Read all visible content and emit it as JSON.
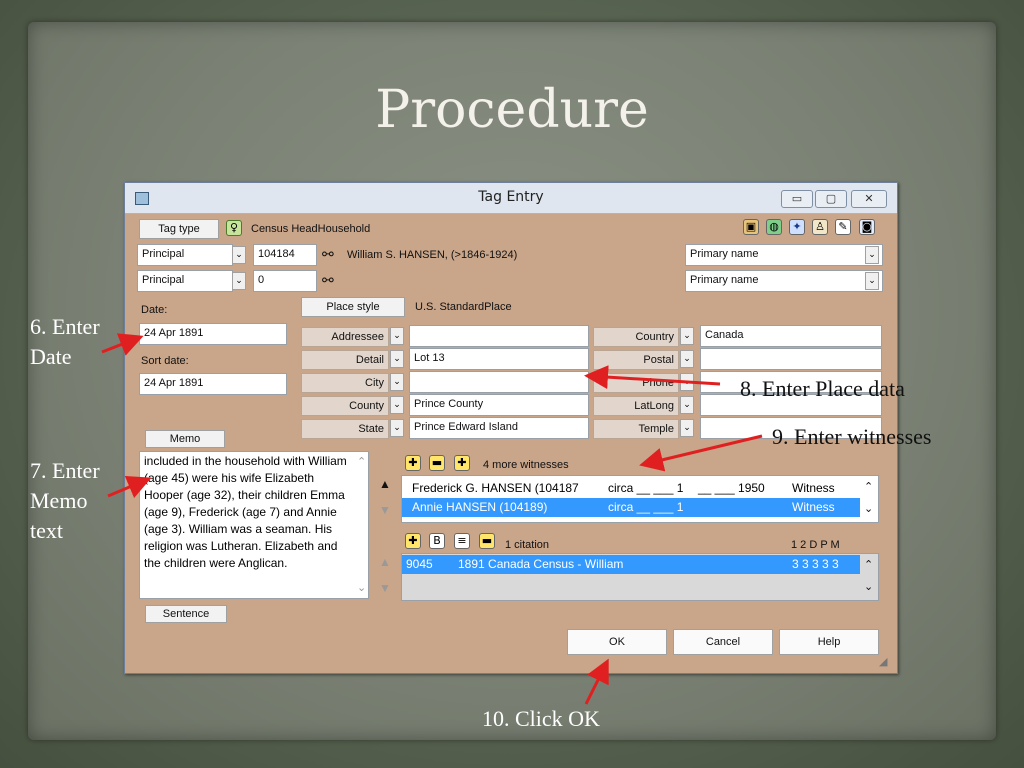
{
  "slide": {
    "title": "Procedure"
  },
  "notes": {
    "date": "6. Enter\nDate",
    "memo": "7. Enter\nMemo\ntext",
    "place": "8. Enter Place data",
    "witnesses": "9. Enter witnesses",
    "ok": "10. Click OK"
  },
  "window": {
    "title": "Tag Entry",
    "buttons": {
      "minimize": "▭",
      "maximize": "▢",
      "close": "✕"
    },
    "tag_type_button": "Tag type",
    "tag_type_value": "Census HeadHousehold",
    "role1": "Principal",
    "id1": "104184",
    "person1": "William S. HANSEN, (>1846-1924)",
    "name_type1": "Primary name",
    "role2": "Principal",
    "id2": "0",
    "name_type2": "Primary name",
    "date_label": "Date:",
    "date_value": "24 Apr 1891",
    "sort_label": "Sort date:",
    "sort_value": "24 Apr 1891",
    "place_style_button": "Place style",
    "place_style_value": "U.S. StandardPlace",
    "place_fields": {
      "addressee": {
        "label": "Addressee",
        "value": ""
      },
      "detail": {
        "label": "Detail",
        "value": "Lot 13"
      },
      "city": {
        "label": "City",
        "value": ""
      },
      "county": {
        "label": "County",
        "value": "Prince County"
      },
      "state": {
        "label": "State",
        "value": "Prince Edward Island"
      },
      "country": {
        "label": "Country",
        "value": "Canada"
      },
      "postal": {
        "label": "Postal",
        "value": ""
      },
      "phone": {
        "label": "Phone",
        "value": ""
      },
      "latlong": {
        "label": "LatLong",
        "value": ""
      },
      "temple": {
        "label": "Temple",
        "value": ""
      }
    },
    "memo_button": "Memo",
    "memo_text": "included in the household with William (age 45) were his wife Elizabeth Hooper (age 32), their children Emma (age 9), Frederick (age 7) and Annie (age 3). William was a seaman.  His religion was Lutheran.  Elizabeth and the children were Anglican.",
    "sentence_button": "Sentence",
    "witness_count": "4 more witnesses",
    "witnesses": [
      {
        "name": "Frederick G. HANSEN (104187",
        "circa": "circa __ ___ 1",
        "circa2": "__ ___ 1950",
        "role": "Witness",
        "selected": false
      },
      {
        "name": "Annie HANSEN (104189)",
        "circa": "circa __ ___ 1",
        "circa2": "",
        "role": "Witness",
        "selected": true
      }
    ],
    "citation_count": "1 citation",
    "citation_cols": "1 2 D P M",
    "citations": [
      {
        "id": "9045",
        "title": "1891 Canada Census - William",
        "scores": "3 3 3 3 3"
      }
    ],
    "ok_button": "OK",
    "cancel_button": "Cancel",
    "help_button": "Help"
  }
}
